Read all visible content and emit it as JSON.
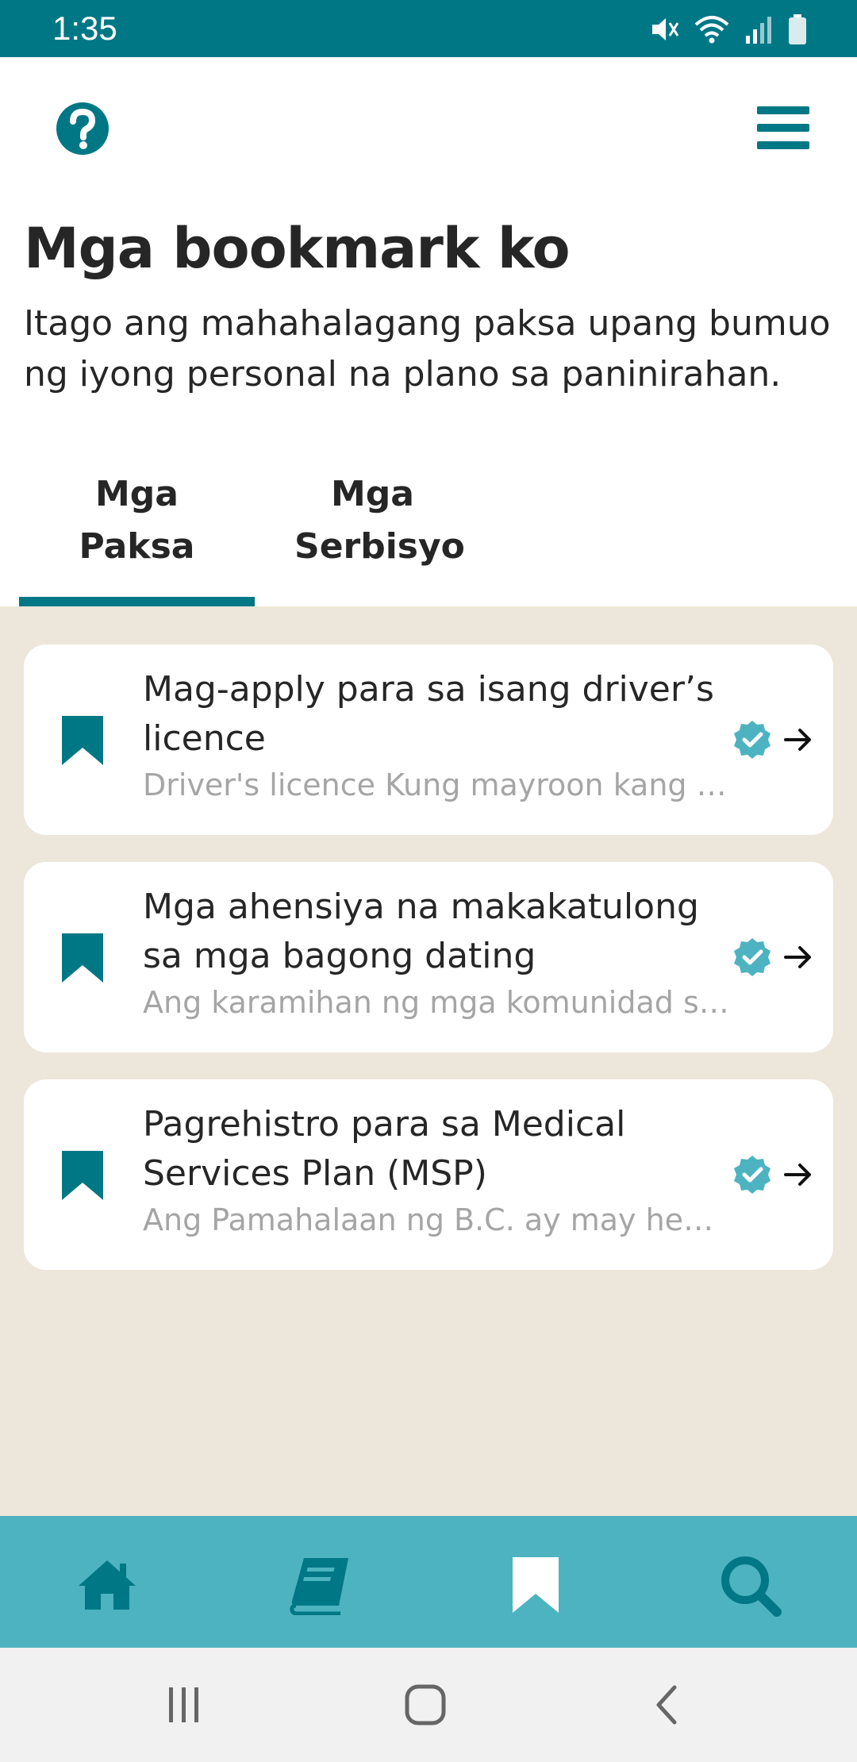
{
  "status_bar": {
    "time": "1:35",
    "icons": [
      "mute-icon",
      "wifi-icon",
      "signal-icon",
      "battery-icon"
    ]
  },
  "header": {
    "help_icon": "question-circle-icon",
    "menu_icon": "hamburger-menu-icon"
  },
  "page": {
    "title": "Mga bookmark ko",
    "subtitle": "Itago ang mahahalagang paksa upang bumuo ng iyong personal na plano sa paninirahan."
  },
  "tabs": [
    {
      "label": "Mga Paksa",
      "active": true
    },
    {
      "label": "Mga Serbisyo",
      "active": false
    }
  ],
  "bookmarks": [
    {
      "title": "Mag-apply para sa isang driver’s licence",
      "description": "Driver's licence  Kung mayroon kang l…"
    },
    {
      "title": "Mga ahensiya na makakatulong sa mga bagong dating",
      "description": "Ang karamihan ng mga komunidad sa.."
    },
    {
      "title": "Pagrehistro para sa Medical Services Plan (MSP)",
      "description": "Ang Pamahalaan ng B.C. ay may heal…"
    }
  ],
  "bottom_nav": [
    {
      "icon": "home-icon",
      "active": false
    },
    {
      "icon": "book-icon",
      "active": false
    },
    {
      "icon": "bookmark-icon",
      "active": true
    },
    {
      "icon": "search-icon",
      "active": false
    }
  ],
  "colors": {
    "primary": "#007785",
    "nav_bar": "#4db3c0",
    "content_bg": "#ede6da",
    "verified": "#4db3c0",
    "muted_text": "#a5a5a5"
  }
}
